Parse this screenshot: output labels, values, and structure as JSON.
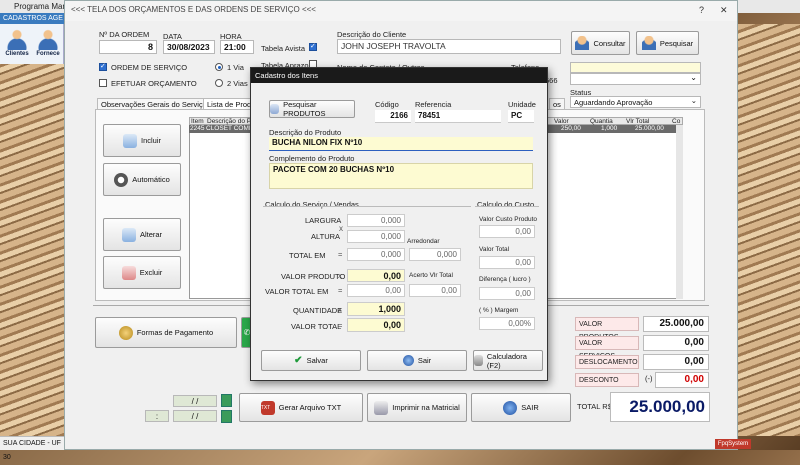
{
  "app": {
    "title": "Programa Manu",
    "menu": "CADASTROS  AGE",
    "status": "SUA CIDADE - UF 30",
    "ribbon": {
      "clientes": "Clientes",
      "fornecedores": "Fornece"
    }
  },
  "window": {
    "title": "<<<  TELA DOS ORÇAMENTOS E DAS ORDENS DE SERVIÇO  <<<",
    "header": {
      "ordem_label": "Nº DA ORDEM",
      "ordem_value": "8",
      "data_label": "DATA",
      "data_value": "30/08/2023",
      "hora_label": "HORA",
      "hora_value": "21:00",
      "tabela_avista": "Tabela Avista",
      "tabela_aprazo": "Tabela Aprazo",
      "ordem_servico": "ORDEM DE SERVIÇO",
      "efetuar_orcamento": "EFETUAR ORÇAMENTO",
      "via1": "1 Via",
      "via2": "2 Vias",
      "cliente_label": "Descrição do Cliente",
      "cliente_value": "JOHN JOSEPH TRAVOLTA",
      "contato_label": "Nome do Contato / Outros",
      "telefone_label": "Telefone",
      "status_label": "Status",
      "status_value": "Aguardando Aprovação",
      "partial_code": "566",
      "btn_consultar": "Consultar",
      "btn_pesquisar": "Pesquisar"
    },
    "tabs": [
      "Observações Gerais do Serviço ->",
      "Lista de Produtos",
      "os"
    ],
    "side_buttons": {
      "incluir": "Incluir",
      "automatico": "Automático",
      "alterar": "Alterar",
      "excluir": "Excluir"
    },
    "grid": {
      "headers": [
        "Item",
        "Descrição do Pr",
        "Valor",
        "Quantia",
        "Vlr Total",
        "Co"
      ],
      "rows": [
        [
          "2245",
          "CLOSET COMP",
          "250,00",
          "1,000",
          "25.000,00",
          ""
        ]
      ]
    },
    "footer": {
      "formas_pagamento": "Formas de Pagamento",
      "gerar_txt": "Gerar Arquivo TXT",
      "imprimir": "Imprimir na Matricial",
      "sair": "SAIR",
      "date1": "/ /",
      "date2": "/ /",
      "time2": ":"
    },
    "totals": {
      "valor_produtos_label": "VALOR PRODUTOS",
      "valor_produtos": "25.000,00",
      "valor_servicos_label": "VALOR SERVIÇOS",
      "valor_servicos": "0,00",
      "deslocamento_label": "DESLOCAMENTO",
      "deslocamento": "0,00",
      "desconto_label": "DESCONTO",
      "desconto_sign": "(-)",
      "desconto": "0,00",
      "total_label": "TOTAL R$",
      "total": "25.000,00"
    },
    "brand": "FpqSystem"
  },
  "dialog": {
    "title": "Cadastro dos Itens",
    "pesquisar_produtos": "Pesquisar PRODUTOS",
    "codigo_label": "Código",
    "codigo": "2166",
    "referencia_label": "Referencia",
    "referencia": "78451",
    "unidade_label": "Unidade",
    "unidade": "PC",
    "descricao_label": "Descrição do Produto",
    "descricao": "BUCHA NILON FIX Nº10",
    "complemento_label": "Complemento do Produto",
    "complemento": "PACOTE COM 20 BUCHAS Nº10",
    "calc_servico": {
      "title": "Calculo do Serviço / Vendas",
      "largura_label": "LARGURA",
      "largura": "0,000",
      "altura_label": "ALTURA",
      "altura": "0,000",
      "arredondar_label": "Arredondar",
      "total_em_label": "TOTAL EM",
      "total_em": "0,000",
      "arredondar": "0,000",
      "valor_produto_label": "VALOR PRODUTO",
      "valor_produto": "0,00",
      "acerto_label": "Acerto Vlr Total",
      "valor_total_em_label": "VALOR TOTAL EM",
      "valor_total_em": "0,00",
      "acerto": "0,00",
      "quantidade_label": "QUANTIDADE",
      "quantidade": "1,000",
      "valor_total_label": "VALOR TOTAL",
      "valor_total": "0,00"
    },
    "calc_custo": {
      "title": "Calculo do Custo",
      "valor_custo_label": "Valor Custo Produto",
      "valor_custo": "0,00",
      "valor_total_label": "Valor Total",
      "valor_total": "0,00",
      "diferenca_label": "Diferença ( lucro )",
      "diferenca": "0,00",
      "margem_label": "( % ) Margem",
      "margem": "0,00%"
    },
    "buttons": {
      "salvar": "Salvar",
      "sair": "Sair",
      "calculadora": "Calculadora  (F2)"
    }
  },
  "colors": {
    "accent": "#2e6fd0",
    "dialog_title": "#1a1a1a",
    "desconto": "#d00000",
    "field_yellow": "#fdfbd2"
  }
}
